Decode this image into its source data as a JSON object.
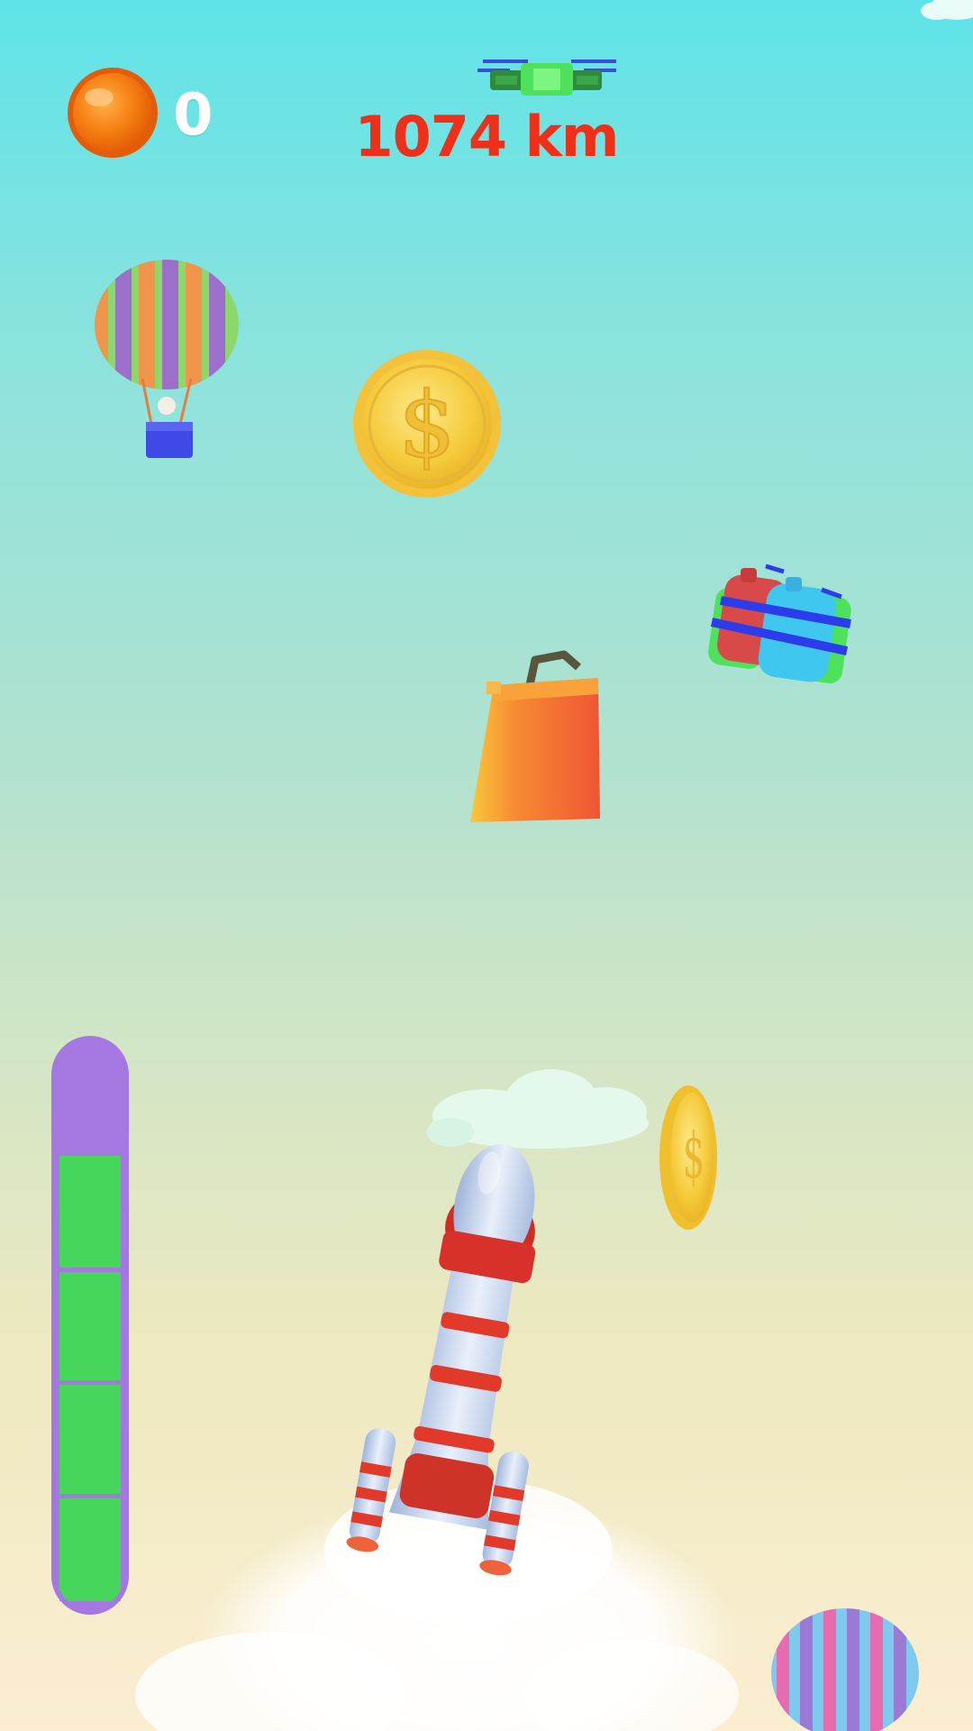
{
  "hud": {
    "coins": "0",
    "distance": "1074 km"
  },
  "fuel_gauge": {
    "level": 0.8,
    "segments": 4
  },
  "scene_objects": {
    "drone_icon": "drone-icon",
    "balloon_icon": "hot-air-balloon-icon",
    "coin_icon": "dollar-coin-icon",
    "fuel_icon": "fuel-canister-icon",
    "bottle_pack_icon": "bottle-pack-icon",
    "rocket_icon": "rocket-icon"
  },
  "colors": {
    "sky_top": "#5fe3e8",
    "sky_bottom": "#fbeed1",
    "distance_text": "#ee2f1a",
    "gauge_frame": "#a577e0",
    "gauge_fill": "#46d65c",
    "coin_gold": "#f6c93a",
    "hud_coin": "#f47a10"
  }
}
